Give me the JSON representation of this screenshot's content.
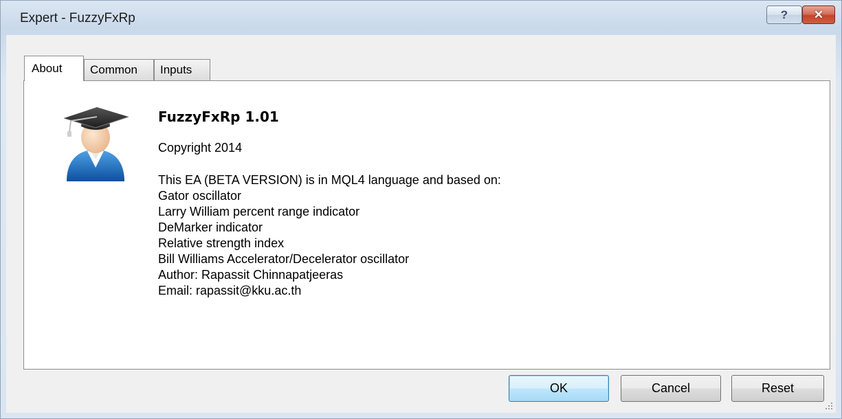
{
  "window": {
    "title": "Expert - FuzzyFxRp",
    "help_label": "?",
    "close_label": "✕"
  },
  "tabs": [
    {
      "label": "About",
      "active": true
    },
    {
      "label": "Common",
      "active": false
    },
    {
      "label": "Inputs",
      "active": false
    }
  ],
  "about": {
    "icon": "graduate-user-icon",
    "title": "FuzzyFxRp 1.01",
    "copyright": "Copyright 2014",
    "description": [
      "This EA (BETA VERSION) is in MQL4 language and based on:",
      "Gator oscillator",
      "Larry William percent range indicator",
      "DeMarker indicator",
      "Relative strength index",
      "Bill Williams Accelerator/Decelerator oscillator",
      "Author: Rapassit Chinnapatjeeras",
      "Email: rapassit@kku.ac.th"
    ]
  },
  "buttons": {
    "ok": "OK",
    "cancel": "Cancel",
    "reset": "Reset"
  },
  "colors": {
    "ok_border": "#3c7fb1",
    "close_button": "#c4452b"
  }
}
